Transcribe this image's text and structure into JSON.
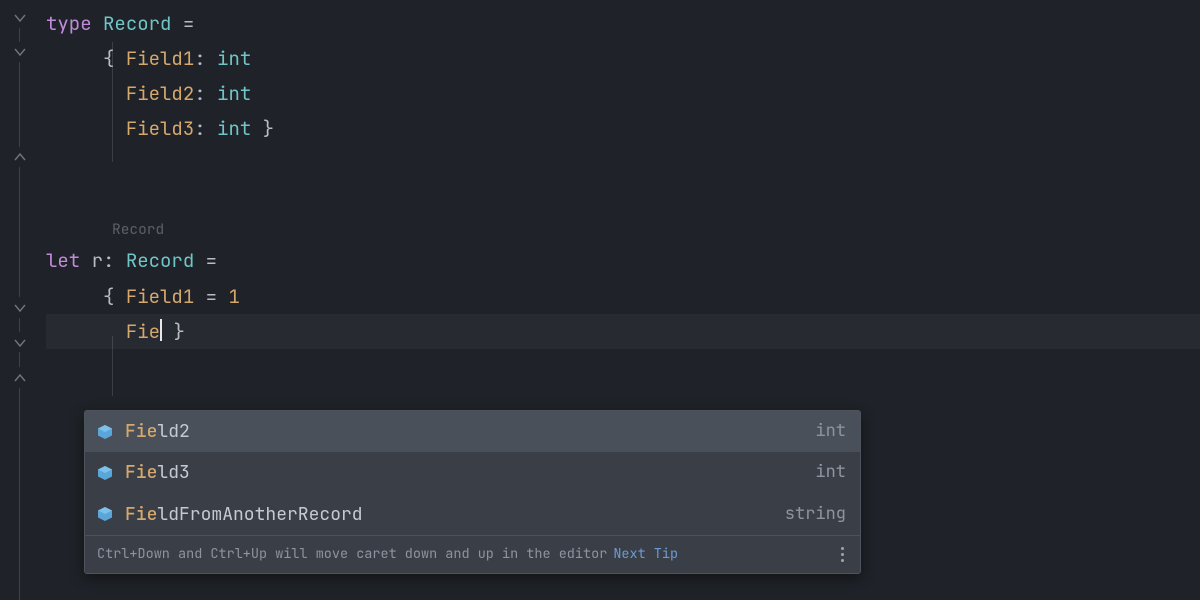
{
  "kw_type": "type",
  "kw_let": "let",
  "type_name": "Record",
  "type_int": "int",
  "field1": "Field1",
  "field2": "Field2",
  "field3": "Field3",
  "eq": " =",
  "colon": ":",
  "obrace": "{",
  "cbrace": "}",
  "space": " ",
  "space5": "     ",
  "space6": "      ",
  "inlay_record": "Record",
  "let_var": "r",
  "one": "1",
  "partial": "Fie",
  "completion": {
    "items": [
      {
        "match": "Fie",
        "rest": "ld2",
        "type": "int",
        "selected": true
      },
      {
        "match": "Fie",
        "rest": "ld3",
        "type": "int",
        "selected": false
      },
      {
        "match": "Fie",
        "rest": "ldFromAnotherRecord",
        "type": "string",
        "selected": false
      }
    ],
    "footer_text": "Ctrl+Down and Ctrl+Up will move caret down and up in the editor",
    "footer_link": "Next Tip"
  }
}
